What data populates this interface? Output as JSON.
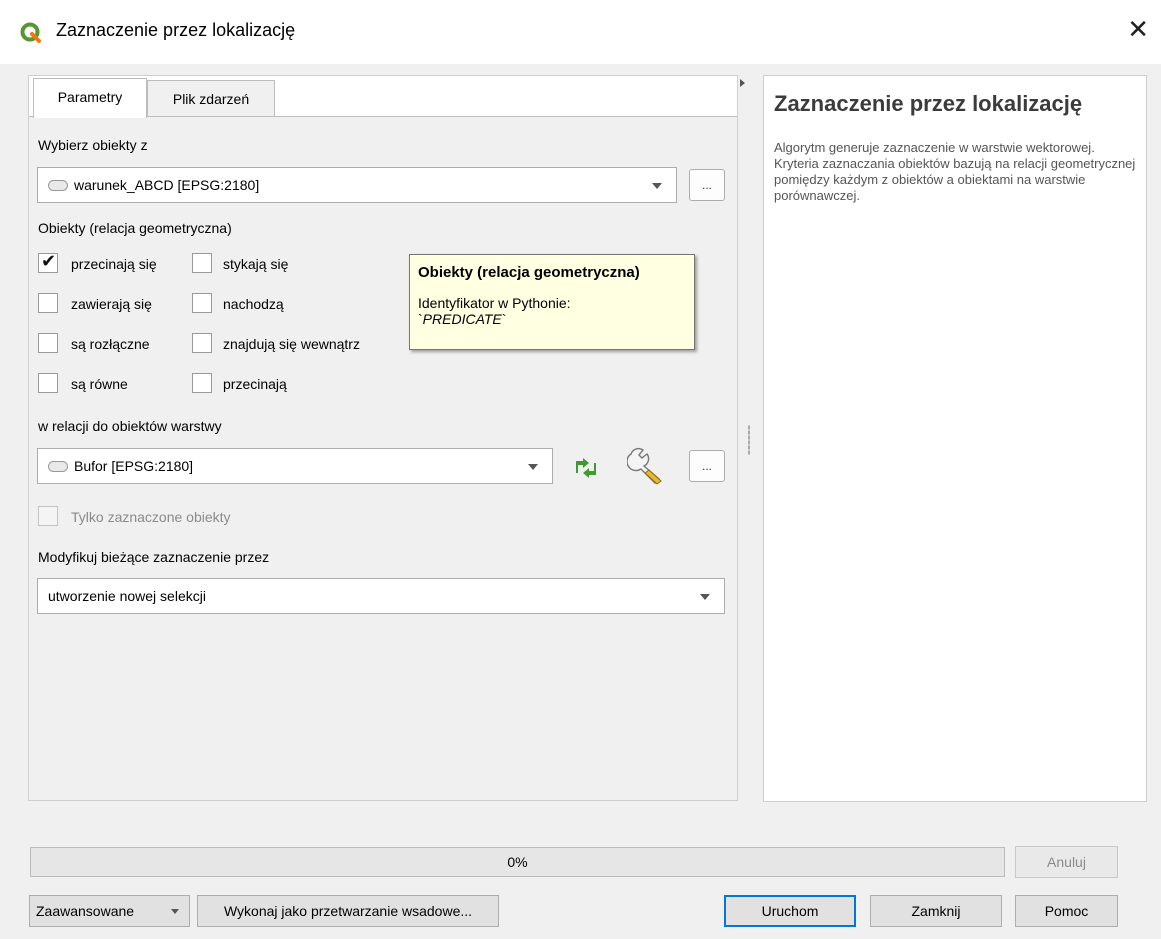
{
  "window": {
    "title": "Zaznaczenie przez lokalizację",
    "close_glyph": "✕"
  },
  "tabs": [
    {
      "label": "Parametry",
      "active": true
    },
    {
      "label": "Plik zdarzeń",
      "active": false
    }
  ],
  "params": {
    "select_from_label": "Wybierz obiekty z",
    "select_from_value": "warunek_ABCD [EPSG:2180]",
    "predicate_label": "Obiekty (relacja geometryczna)",
    "predicates": [
      {
        "label": "przecinają się",
        "checked": true
      },
      {
        "label": "stykają się",
        "checked": false
      },
      {
        "label": "zawierają się",
        "checked": false
      },
      {
        "label": "nachodzą",
        "checked": false
      },
      {
        "label": "są rozłączne",
        "checked": false
      },
      {
        "label": "znajdują się wewnątrz",
        "checked": false
      },
      {
        "label": "są równe",
        "checked": false
      },
      {
        "label": "przecinają",
        "checked": false
      }
    ],
    "compare_label": "w relacji do obiektów warstwy",
    "compare_value": "Bufor [EPSG:2180]",
    "selected_only_label": "Tylko zaznaczone obiekty",
    "modify_label": "Modyfikuj bieżące zaznaczenie przez",
    "modify_value": "utworzenie nowej selekcji",
    "dots_label": "..."
  },
  "tooltip": {
    "title": "Obiekty (relacja geometryczna)",
    "line": "Identyfikator w Pythonie:",
    "identifier_prefix": "`",
    "identifier": "PREDICATE",
    "identifier_suffix": "`"
  },
  "help": {
    "title": "Zaznaczenie przez lokalizację",
    "body": "Algorytm generuje zaznaczenie w warstwie wektorowej. Kryteria zaznaczania obiektów bazują na relacji geometrycznej pomiędzy każdym z obiektów a obiektami na warstwie porównawczej."
  },
  "progress": {
    "value": 0,
    "text": "0%"
  },
  "buttons": {
    "cancel": "Anuluj",
    "advanced": "Zaawansowane",
    "batch": "Wykonaj jako przetwarzanie wsadowe...",
    "run": "Uruchom",
    "close": "Zamknij",
    "help": "Pomoc"
  },
  "icons": {
    "app": "qgis-logo-icon",
    "layer": "polygon-layer-icon",
    "iterate": "iterate-icon",
    "settings": "wrench-icon"
  },
  "colors": {
    "qgis_green": "#589632",
    "iterate_green": "#3f9b2d",
    "tooltip_bg": "#ffffe1",
    "default_button_border": "#0078d7"
  }
}
